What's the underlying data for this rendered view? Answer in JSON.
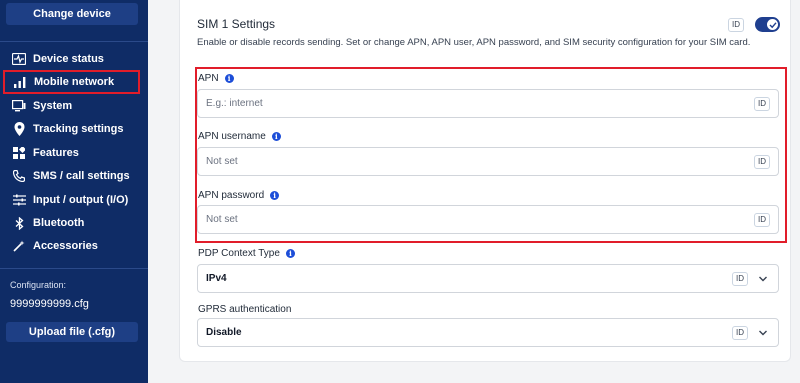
{
  "sidebar": {
    "change_device": "Change device",
    "items": [
      {
        "label": "Device status",
        "icon": "pulse-icon"
      },
      {
        "label": "Mobile network",
        "icon": "signal-bars-icon"
      },
      {
        "label": "System",
        "icon": "monitor-icon"
      },
      {
        "label": "Tracking settings",
        "icon": "location-pin-icon"
      },
      {
        "label": "Features",
        "icon": "grid-icon"
      },
      {
        "label": "SMS / call settings",
        "icon": "phone-icon"
      },
      {
        "label": "Input / output (I/O)",
        "icon": "sliders-icon"
      },
      {
        "label": "Bluetooth",
        "icon": "bluetooth-icon"
      },
      {
        "label": "Accessories",
        "icon": "wand-icon"
      }
    ],
    "config_label": "Configuration:",
    "config_file": "9999999999.cfg",
    "upload_label": "Upload file (.cfg)"
  },
  "card": {
    "title": "SIM 1 Settings",
    "description": "Enable or disable records sending. Set or change APN, APN user, APN password, and SIM security configuration for your SIM card.",
    "id_badge": "ID",
    "toggle_on": true
  },
  "fields": {
    "apn": {
      "label": "APN",
      "placeholder": "E.g.: internet"
    },
    "apn_username": {
      "label": "APN username",
      "value": "Not set"
    },
    "apn_password": {
      "label": "APN password",
      "value": "Not set"
    },
    "pdp_context": {
      "label": "PDP Context Type",
      "value": "IPv4"
    },
    "gprs_auth": {
      "label": "GPRS authentication",
      "value": "Disable"
    }
  },
  "colors": {
    "sidebar_bg": "#0f2c66",
    "accent": "#1f3f8f",
    "highlight": "#e11d2a"
  }
}
